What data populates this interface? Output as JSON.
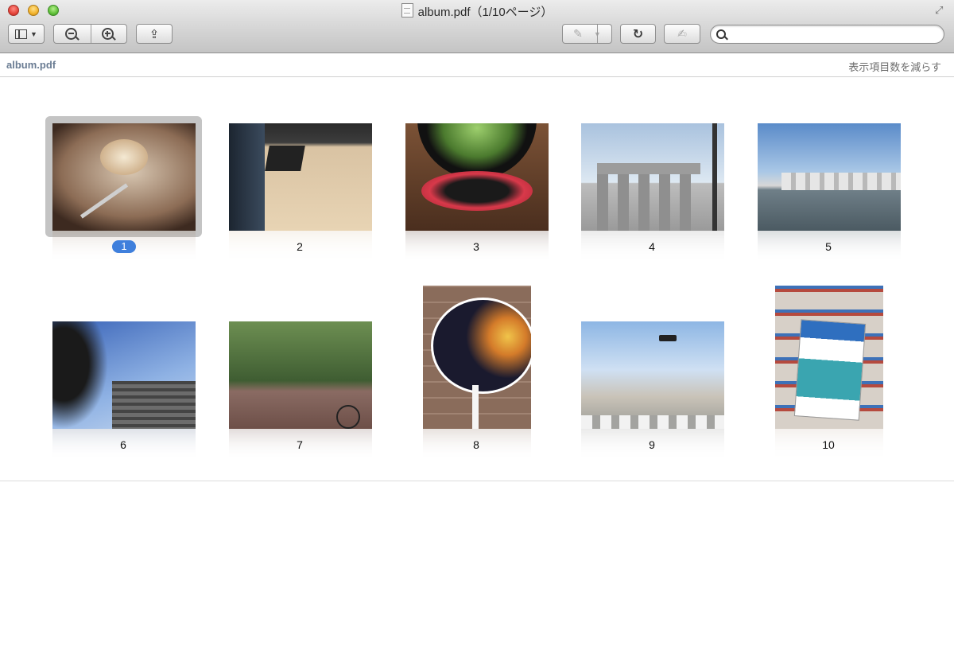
{
  "window": {
    "title": "album.pdf（1/10ページ）"
  },
  "path": {
    "file": "album.pdf",
    "reduce_label": "表示項目数を減らす"
  },
  "search": {
    "placeholder": "",
    "value": ""
  },
  "colors": {
    "selection": "#3f7fdc",
    "path_text": "#6a7c93"
  },
  "icons": [
    "sidebar-icon",
    "zoom-out-icon",
    "zoom-in-icon",
    "share-icon",
    "annotate-icon",
    "rotate-icon",
    "edit-icon",
    "search-icon"
  ],
  "pages": [
    {
      "num": "1",
      "selected": true
    },
    {
      "num": "2"
    },
    {
      "num": "3"
    },
    {
      "num": "4"
    },
    {
      "num": "5"
    },
    {
      "num": "6"
    },
    {
      "num": "7"
    },
    {
      "num": "8"
    },
    {
      "num": "9"
    },
    {
      "num": "10"
    }
  ]
}
